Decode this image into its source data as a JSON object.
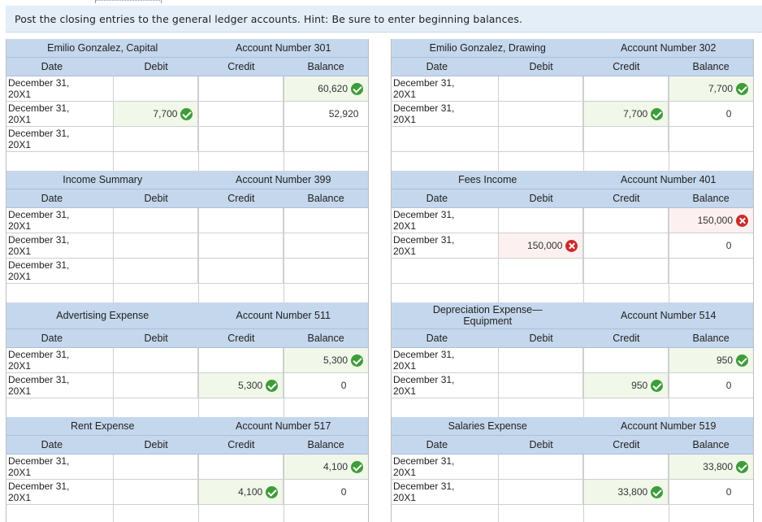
{
  "instruction": "Post the closing entries to the general ledger accounts. Hint: Be sure to enter beginning balances.",
  "headers": {
    "date": "Date",
    "debit": "Debit",
    "credit": "Credit",
    "balance": "Balance"
  },
  "colors": {
    "header_bg": "#c5d7ec",
    "instruction_bg": "#e4eef8",
    "correct": "#3e9c3a",
    "incorrect": "#cc2b2b"
  },
  "ledgers": [
    {
      "name": "Emilio Gonzalez, Capital",
      "number": "Account Number 301",
      "rows": [
        {
          "date": "December 31,\n20X1",
          "debit": "",
          "credit": "",
          "balance": "60,620",
          "balance_status": "correct"
        },
        {
          "date": "December 31,\n20X1",
          "debit": "7,700",
          "debit_status": "correct",
          "credit": "",
          "balance": "52,920"
        },
        {
          "date": "December 31,\n20X1",
          "debit": "",
          "credit": "",
          "balance": ""
        }
      ]
    },
    {
      "name": "Emilio Gonzalez, Drawing",
      "number": "Account Number 302",
      "rows": [
        {
          "date": "December 31,\n20X1",
          "debit": "",
          "credit": "",
          "balance": "7,700",
          "balance_status": "correct"
        },
        {
          "date": "December 31,\n20X1",
          "debit": "",
          "credit": "7,700",
          "credit_status": "correct",
          "balance": "0"
        },
        {
          "date": "",
          "debit": "",
          "credit": "",
          "balance": ""
        }
      ]
    },
    {
      "name": "Income Summary",
      "number": "Account Number 399",
      "rows": [
        {
          "date": "December 31,\n20X1",
          "debit": "",
          "credit": "",
          "balance": ""
        },
        {
          "date": "December 31,\n20X1",
          "debit": "",
          "credit": "",
          "balance": ""
        },
        {
          "date": "December 31,\n20X1",
          "debit": "",
          "credit": "",
          "balance": ""
        }
      ]
    },
    {
      "name": "Fees Income",
      "number": "Account Number 401",
      "rows": [
        {
          "date": "December 31,\n20X1",
          "debit": "",
          "credit": "",
          "balance": "150,000",
          "balance_status": "incorrect"
        },
        {
          "date": "December 31,\n20X1",
          "debit": "150,000",
          "debit_status": "incorrect",
          "credit": "",
          "balance": "0"
        },
        {
          "date": "",
          "debit": "",
          "credit": "",
          "balance": ""
        }
      ]
    },
    {
      "name": "Advertising Expense",
      "number": "Account Number 511",
      "rows": [
        {
          "date": "December 31,\n20X1",
          "debit": "",
          "credit": "",
          "balance": "5,300",
          "balance_status": "correct"
        },
        {
          "date": "December 31,\n20X1",
          "debit": "",
          "credit": "5,300",
          "credit_status": "correct",
          "balance": "0"
        }
      ]
    },
    {
      "name": "Depreciation Expense—\nEquipment",
      "number": "Account Number 514",
      "rows": [
        {
          "date": "December 31,\n20X1",
          "debit": "",
          "credit": "",
          "balance": "950",
          "balance_status": "correct"
        },
        {
          "date": "December 31,\n20X1",
          "debit": "",
          "credit": "950",
          "credit_status": "correct",
          "balance": "0"
        }
      ]
    },
    {
      "name": "Rent Expense",
      "number": "Account Number 517",
      "rows": [
        {
          "date": "December 31,\n20X1",
          "debit": "",
          "credit": "",
          "balance": "4,100",
          "balance_status": "correct"
        },
        {
          "date": "December 31,\n20X1",
          "debit": "",
          "credit": "4,100",
          "credit_status": "correct",
          "balance": "0"
        }
      ]
    },
    {
      "name": "Salaries Expense",
      "number": "Account Number 519",
      "rows": [
        {
          "date": "December 31,\n20X1",
          "debit": "",
          "credit": "",
          "balance": "33,800",
          "balance_status": "correct"
        },
        {
          "date": "December 31,\n20X1",
          "debit": "",
          "credit": "33,800",
          "credit_status": "correct",
          "balance": "0"
        }
      ]
    }
  ]
}
